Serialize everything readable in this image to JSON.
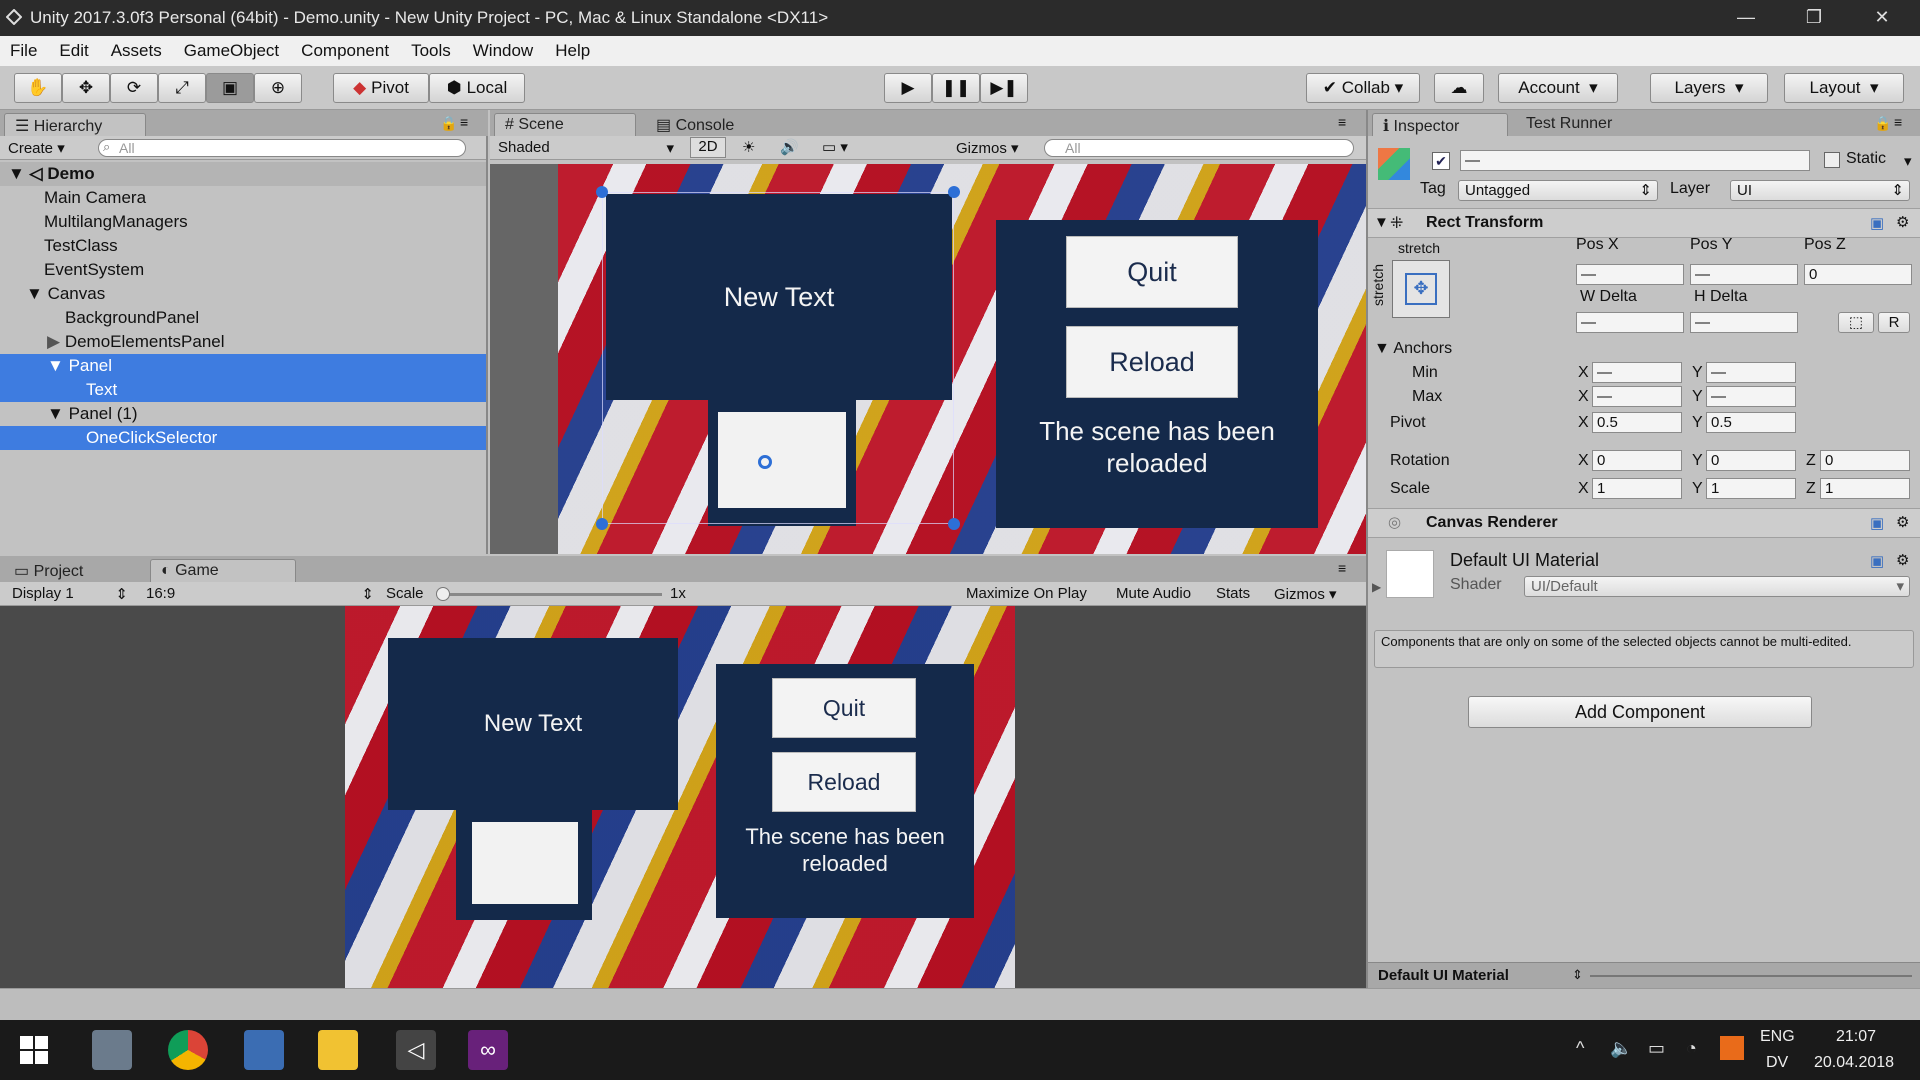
{
  "window": {
    "title": "Unity 2017.3.0f3 Personal (64bit) - Demo.unity - New Unity Project - PC, Mac & Linux Standalone <DX11>",
    "minimize": "—",
    "maximize": "❐",
    "close": "✕"
  },
  "menu": [
    "File",
    "Edit",
    "Assets",
    "GameObject",
    "Component",
    "Tools",
    "Window",
    "Help"
  ],
  "toolbar": {
    "pivot": "Pivot",
    "local": "Local",
    "collab": "Collab",
    "account": "Account",
    "layers": "Layers",
    "layout": "Layout"
  },
  "hierarchy": {
    "tab": "Hierarchy",
    "create": "Create",
    "search_placeholder": "All",
    "scene": "Demo",
    "items": [
      "Main Camera",
      "MultilangManagers",
      "TestClass",
      "EventSystem",
      "Canvas",
      "BackgroundPanel",
      "DemoElementsPanel",
      "Panel",
      "Text",
      "Panel (1)",
      "OneClickSelector"
    ]
  },
  "scene": {
    "tab": "Scene",
    "console_tab": "Console",
    "shading": "Shaded",
    "mode2d": "2D",
    "gizmos": "Gizmos",
    "search_placeholder": "All"
  },
  "game": {
    "project_tab": "Project",
    "game_tab": "Game",
    "display": "Display 1",
    "aspect": "16:9",
    "scale_label": "Scale",
    "scale_value": "1x",
    "maximize": "Maximize On Play",
    "mute": "Mute Audio",
    "stats": "Stats",
    "gizmos": "Gizmos"
  },
  "ui_preview": {
    "new_text": "New Text",
    "quit": "Quit",
    "reload": "Reload",
    "message": "The scene has been reloaded"
  },
  "inspector": {
    "tab": "Inspector",
    "test_runner_tab": "Test Runner",
    "name_value": "—",
    "static_label": "Static",
    "tag_label": "Tag",
    "tag_value": "Untagged",
    "layer_label": "Layer",
    "layer_value": "UI",
    "rect_transform": "Rect Transform",
    "stretch_top": "stretch",
    "stretch_side": "stretch",
    "pos_x": "Pos X",
    "pos_y": "Pos Y",
    "pos_z": "Pos Z",
    "pos_x_val": "—",
    "pos_y_val": "—",
    "pos_z_val": "0",
    "w_delta": "W Delta",
    "h_delta": "H Delta",
    "w_val": "—",
    "h_val": "—",
    "r_btn": "R",
    "anchors": "Anchors",
    "min": "Min",
    "max": "Max",
    "pivot": "Pivot",
    "rotation": "Rotation",
    "scale": "Scale",
    "x": "X",
    "y": "Y",
    "z": "Z",
    "min_x": "—",
    "min_y": "—",
    "max_x": "—",
    "max_y": "—",
    "pivot_x": "0.5",
    "pivot_y": "0.5",
    "rot_x": "0",
    "rot_y": "0",
    "rot_z": "0",
    "scale_x": "1",
    "scale_y": "1",
    "scale_z": "1",
    "canvas_renderer": "Canvas Renderer",
    "material": "Default UI Material",
    "shader_label": "Shader",
    "shader_value": "UI/Default",
    "note": "Components that are only on some of the selected objects cannot be multi-edited.",
    "add_component": "Add Component",
    "preview_label": "Default UI Material"
  },
  "taskbar": {
    "lang1": "ENG",
    "lang2": "DV",
    "time": "21:07",
    "date": "20.04.2018"
  }
}
